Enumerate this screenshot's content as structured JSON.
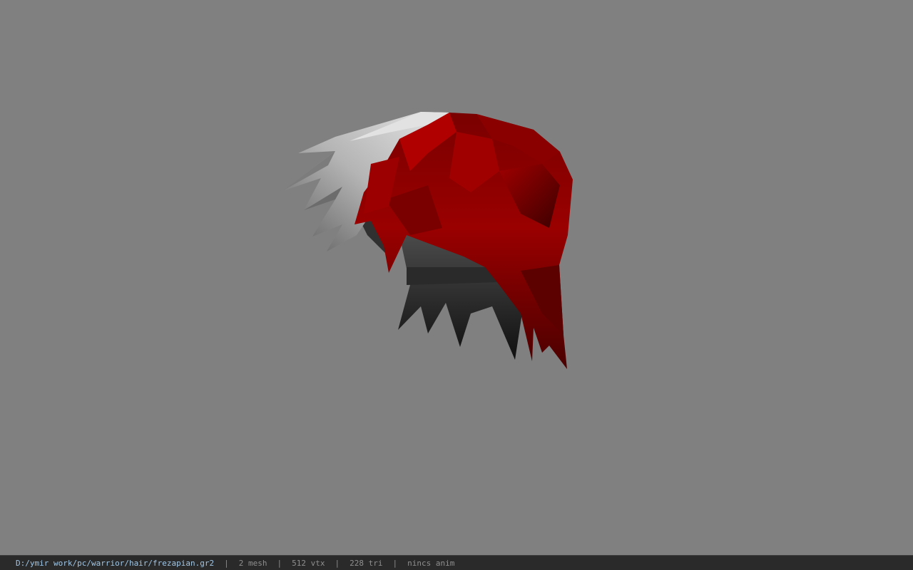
{
  "viewer": {
    "background_color": "#808080",
    "model": {
      "name": "frezapian.gr2",
      "hair_color": "#8b0000",
      "highlight_color": "#c8c8c8",
      "inner_color": "#1e1e1e"
    }
  },
  "status_bar": {
    "file_path": "D:/ymir work/pc/warrior/hair/frezapian.gr2",
    "separator": "|",
    "mesh_count": "2 mesh",
    "vertex_count": "512 vtx",
    "triangle_count": "228 tri",
    "anim_status": "nincs anim"
  }
}
